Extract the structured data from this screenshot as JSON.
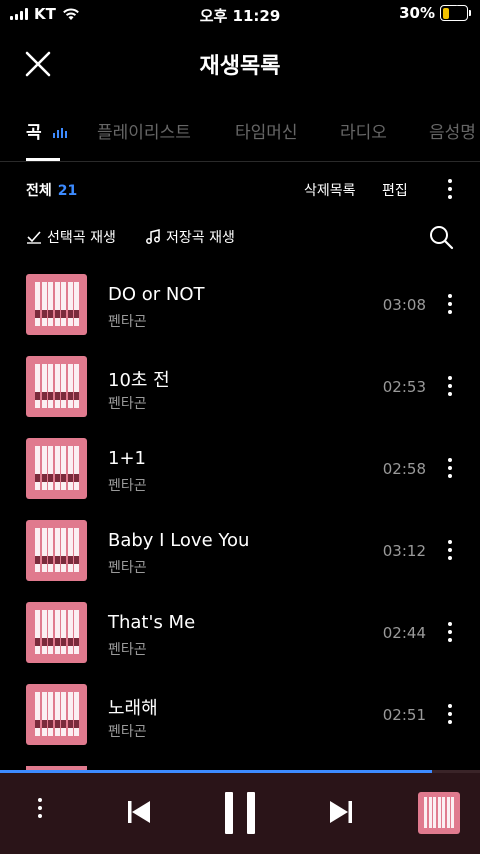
{
  "status_bar": {
    "carrier": "KT",
    "time": "오후 11:29",
    "battery": "30%",
    "battery_level": 0.3
  },
  "header": {
    "title": "재생목록",
    "close_icon": "close-icon"
  },
  "tabs": [
    {
      "label": "곡",
      "active": true
    },
    {
      "label": "플레이리스트",
      "active": false
    },
    {
      "label": "타임머신",
      "active": false
    },
    {
      "label": "라디오",
      "active": false
    },
    {
      "label": "음성명",
      "active": false
    }
  ],
  "toolbar": {
    "total_label": "전체",
    "total_count": "21",
    "deleted_label": "삭제목록",
    "edit_label": "편집"
  },
  "actions": {
    "play_selected": "선택곡 재생",
    "play_saved": "저장곡 재생"
  },
  "songs": [
    {
      "title": "DO or NOT",
      "artist": "펜타곤",
      "duration": "03:08"
    },
    {
      "title": "10초 전",
      "artist": "펜타곤",
      "duration": "02:53"
    },
    {
      "title": "1+1",
      "artist": "펜타곤",
      "duration": "02:58"
    },
    {
      "title": "Baby I Love You",
      "artist": "펜타곤",
      "duration": "03:12"
    },
    {
      "title": "That's Me",
      "artist": "펜타곤",
      "duration": "02:44"
    },
    {
      "title": "노래해",
      "artist": "펜타곤",
      "duration": "02:51"
    }
  ],
  "player": {
    "progress": 0.9,
    "accent": "#3d8bff"
  },
  "colors": {
    "accent": "#3d8bff",
    "player_bg": "#2a1418",
    "album_pink": "#e07a8e"
  }
}
